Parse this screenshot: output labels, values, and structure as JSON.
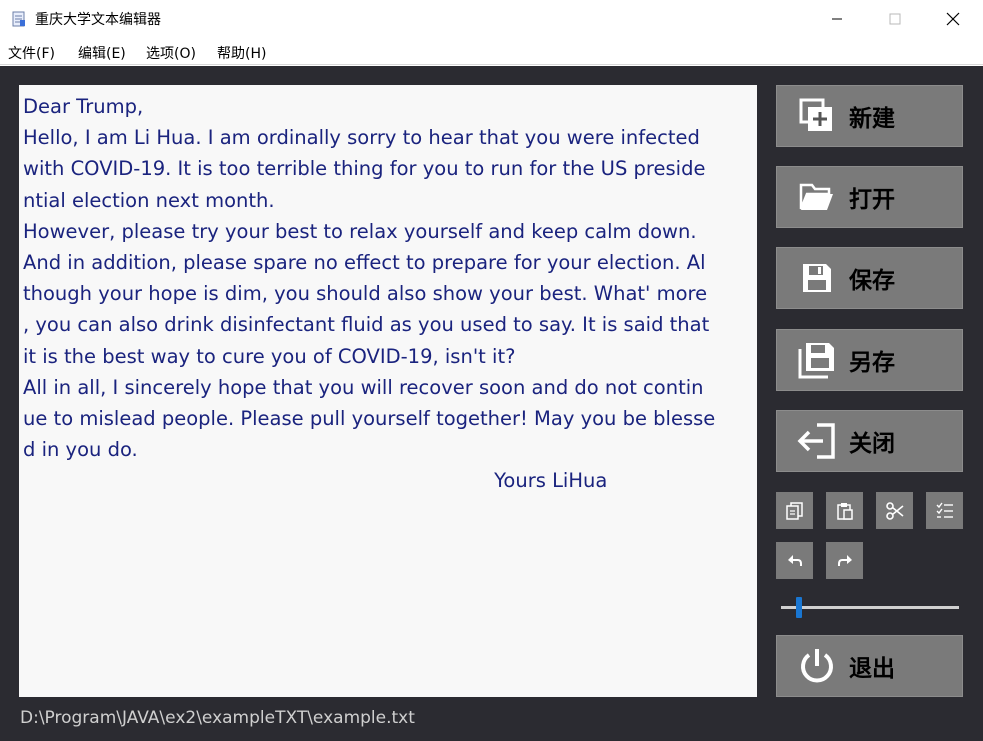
{
  "window": {
    "title": "重庆大学文本编辑器",
    "app_icon": "notepad-icon",
    "controls": [
      "minimize-icon",
      "maximize-icon",
      "close-icon"
    ]
  },
  "menu": {
    "items": [
      "文件(F)",
      "编辑(E)",
      "选项(O)",
      "帮助(H)"
    ]
  },
  "editor": {
    "lines": [
      "Dear Trump,",
      "Hello, I am Li Hua. I am ordinally sorry to hear that you were infected",
      "with COVID-19. It is too terrible thing for you to run for the US preside",
      "ntial election next month.",
      "However, please try your best to relax yourself and keep calm down.",
      "And in addition, please spare no effect to prepare for your election. Al",
      "though your hope is dim, you should also show your best. What' more",
      ", you can also drink disinfectant fluid as you used to say. It is said that",
      "it is the best way to cure you of COVID-19, isn't it?",
      "All in all, I sincerely hope that you will recover soon and do not contin",
      "ue to mislead people. Please pull yourself together! May you be blesse",
      "d in you do.",
      "                                                                            Yours LiHua"
    ],
    "text_color": "#1a237e",
    "background": "#f8f8f8"
  },
  "sidebar": {
    "buttons": [
      {
        "label": "新建",
        "icon": "new-file-icon"
      },
      {
        "label": "打开",
        "icon": "folder-open-icon"
      },
      {
        "label": "保存",
        "icon": "save-icon"
      },
      {
        "label": "另存",
        "icon": "save-as-icon"
      },
      {
        "label": "关闭",
        "icon": "logout-icon"
      }
    ],
    "tools": [
      "copy-icon",
      "paste-icon",
      "cut-icon",
      "select-all-icon",
      "undo-icon",
      "redo-icon"
    ],
    "font_size_slider": {
      "value": 0.09
    },
    "exit_button": {
      "label": "退出",
      "icon": "power-icon"
    }
  },
  "status": {
    "path": "D:\\Program\\JAVA\\ex2\\exampleTXT\\example.txt"
  },
  "colors": {
    "workspace": "#2b2b31",
    "button": "#7a7a7a",
    "accent": "#1976d2"
  }
}
